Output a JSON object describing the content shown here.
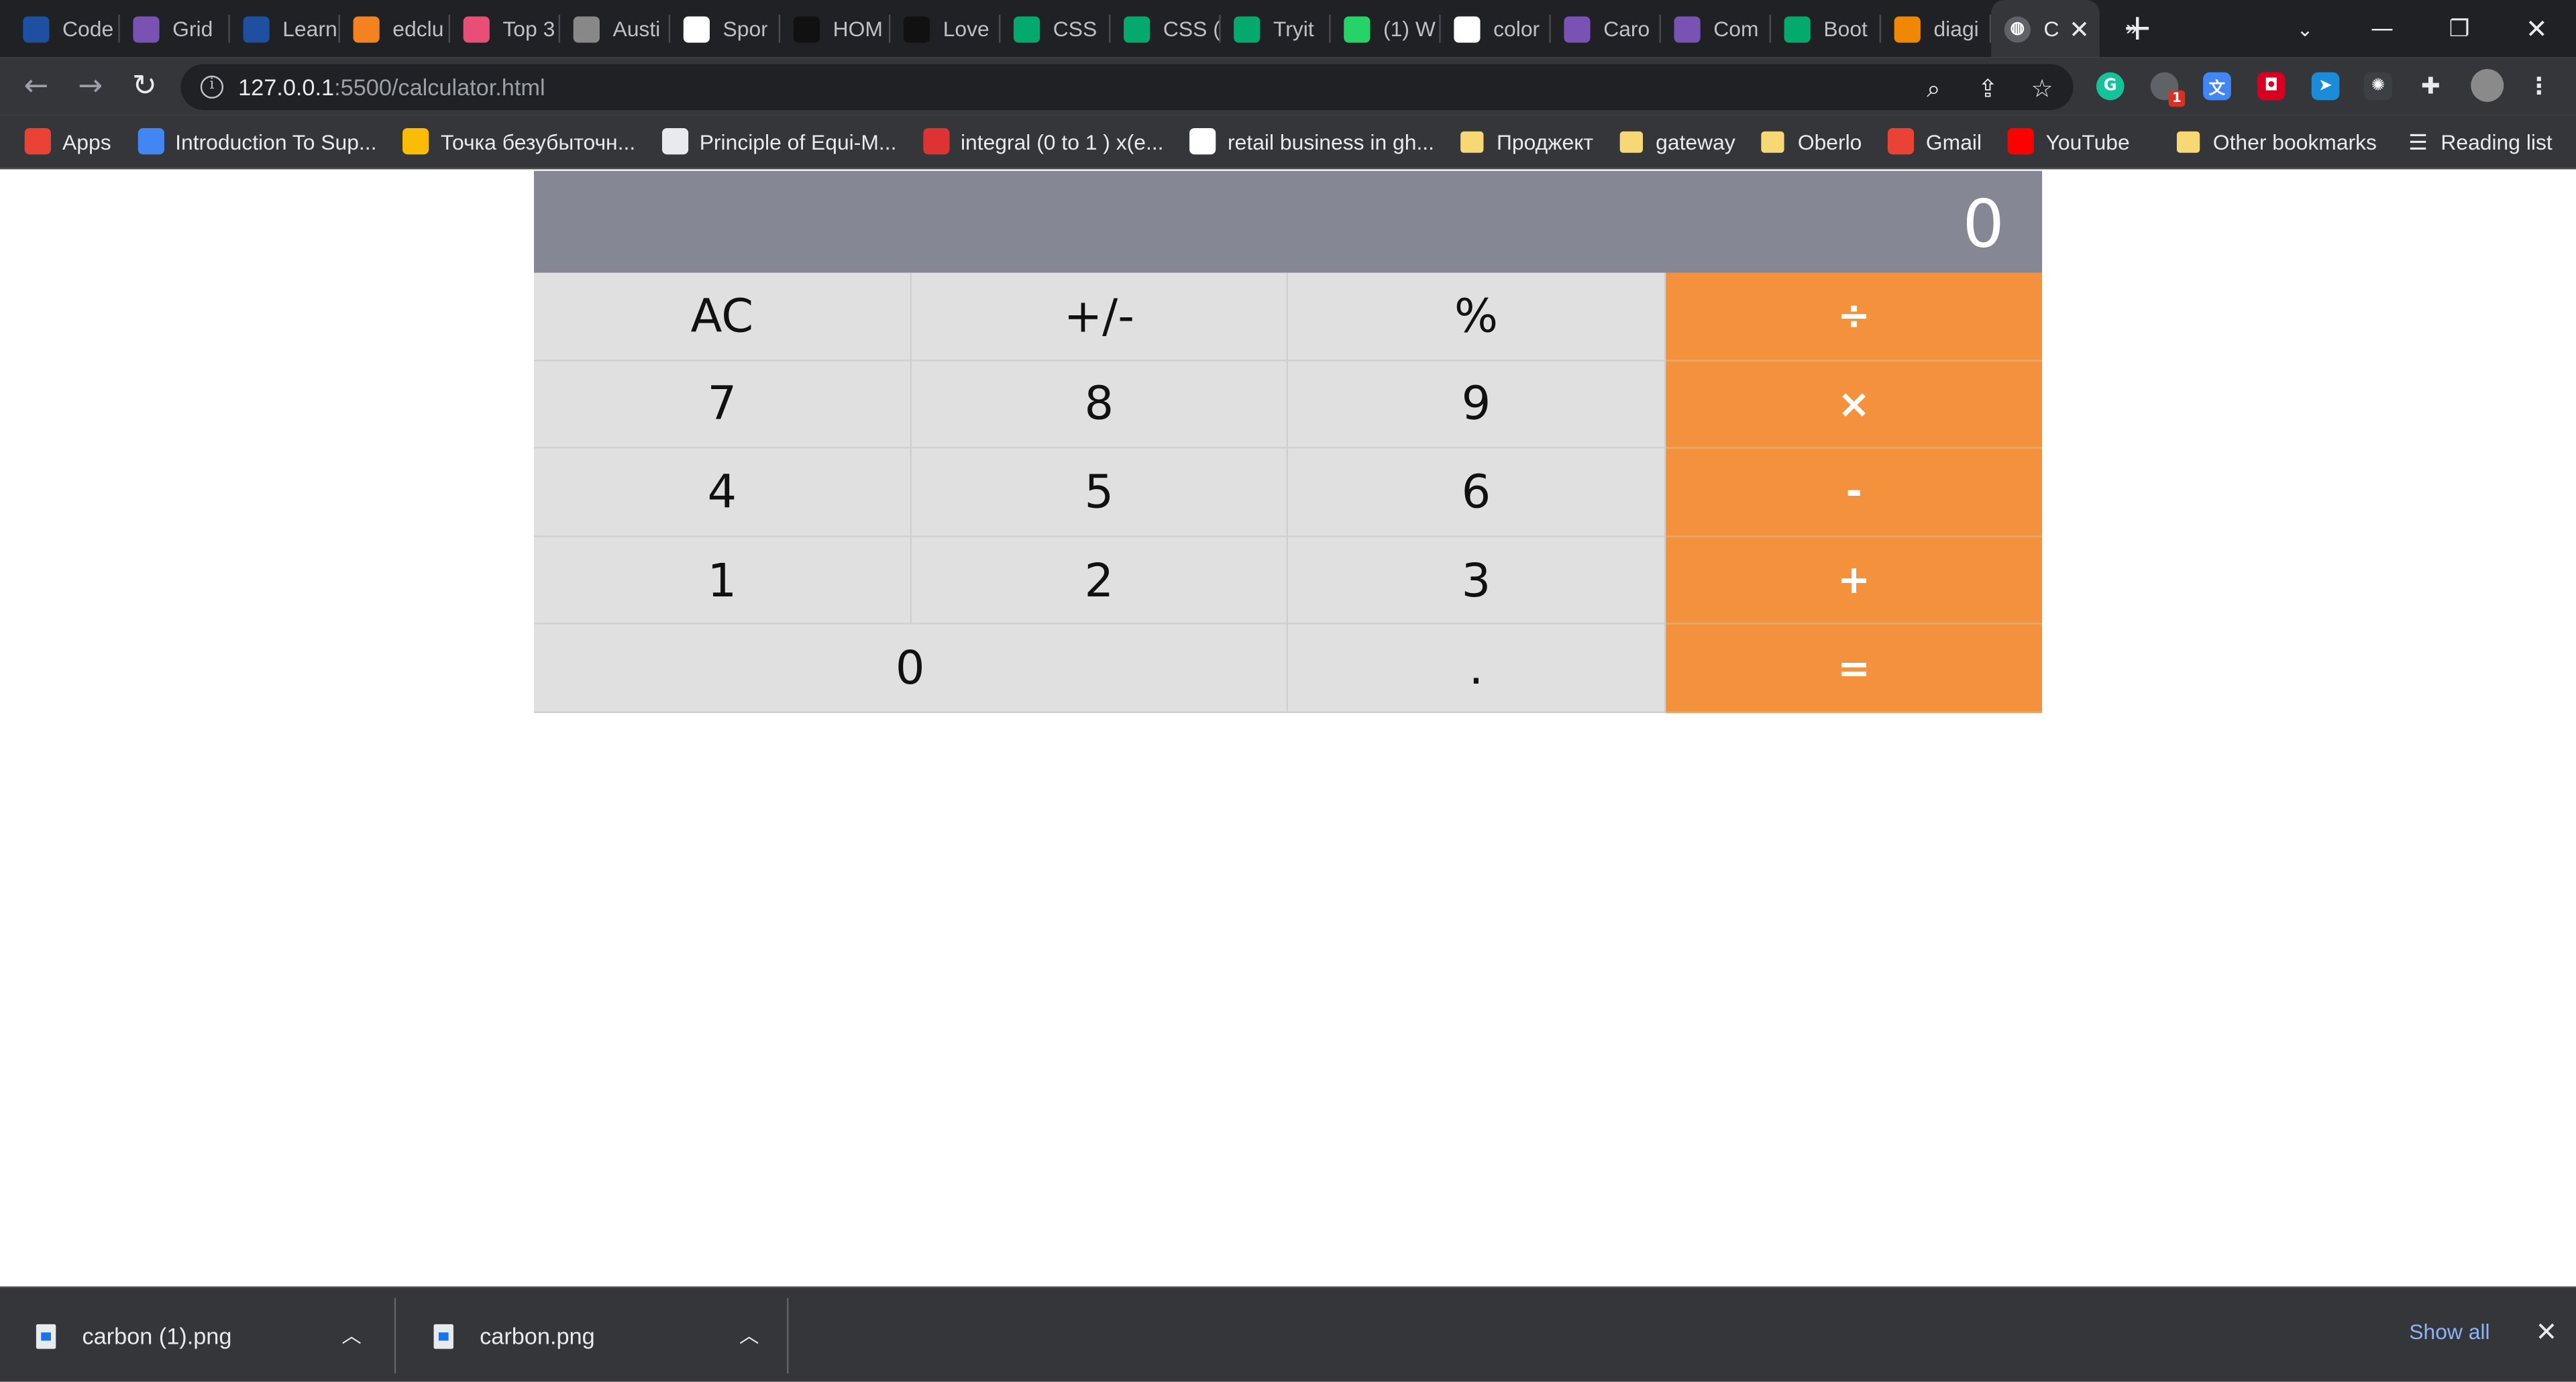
{
  "browser": {
    "tabs": [
      {
        "label": "Code",
        "icon": "codepen-icon",
        "color": "#1e4fa0"
      },
      {
        "label": "Grid",
        "icon": "bootstrap-icon",
        "color": "#7952b3"
      },
      {
        "label": "Learn",
        "icon": "codepen-icon",
        "color": "#1e4fa0"
      },
      {
        "label": "edclu",
        "icon": "flame-icon",
        "color": "#f58220"
      },
      {
        "label": "Top 3",
        "icon": "mail-icon",
        "color": "#e94e77"
      },
      {
        "label": "Austi",
        "icon": "portrait-icon",
        "color": "#888888"
      },
      {
        "label": "Spor",
        "icon": "ls-icon",
        "color": "#ffffff"
      },
      {
        "label": "HOM",
        "icon": "plus-minus-icon",
        "color": "#111111"
      },
      {
        "label": "Love",
        "icon": "to-icon",
        "color": "#111111"
      },
      {
        "label": "CSS",
        "icon": "w3schools-icon",
        "color": "#04aa6d"
      },
      {
        "label": "CSS (",
        "icon": "w3schools-icon",
        "color": "#04aa6d"
      },
      {
        "label": "Tryit",
        "icon": "w3schools-icon",
        "color": "#04aa6d"
      },
      {
        "label": "(1) W",
        "icon": "whatsapp-icon",
        "color": "#25d366"
      },
      {
        "label": "color",
        "icon": "google-icon",
        "color": "#ffffff"
      },
      {
        "label": "Caro",
        "icon": "bootstrap-icon",
        "color": "#7952b3"
      },
      {
        "label": "Com",
        "icon": "bootstrap-icon",
        "color": "#7952b3"
      },
      {
        "label": "Boot",
        "icon": "w3schools-icon",
        "color": "#04aa6d"
      },
      {
        "label": "diagi",
        "icon": "diagram-icon",
        "color": "#f08705"
      }
    ],
    "active_tab": {
      "label": "C",
      "icon": "globe-icon"
    },
    "url_host": "127.0.0.1",
    "url_path": ":5500/calculator.html",
    "bookmarks": [
      {
        "label": "Apps",
        "icon": "apps-grid-icon"
      },
      {
        "label": "Introduction To Sup...",
        "icon": "chart-line-icon"
      },
      {
        "label": "Точка безубыточн...",
        "icon": "bar-chart-icon"
      },
      {
        "label": "Principle of Equi-M...",
        "icon": "globe-icon"
      },
      {
        "label": "integral (0 to 1 ) x(e...",
        "icon": "symbolab-icon"
      },
      {
        "label": "retail business in gh...",
        "icon": "google-icon"
      },
      {
        "label": "Проджект",
        "icon": "folder-icon"
      },
      {
        "label": "gateway",
        "icon": "folder-icon"
      },
      {
        "label": "Oberlo",
        "icon": "folder-icon"
      },
      {
        "label": "Gmail",
        "icon": "gmail-icon"
      },
      {
        "label": "YouTube",
        "icon": "youtube-icon"
      }
    ],
    "more_bookmarks": "»",
    "other_bookmarks": "Other bookmarks",
    "reading_list": "Reading list"
  },
  "calculator": {
    "display": "0",
    "keys": [
      {
        "label": "AC",
        "type": "fn"
      },
      {
        "label": "+/-",
        "type": "fn"
      },
      {
        "label": "%",
        "type": "fn"
      },
      {
        "label": "÷",
        "type": "op"
      },
      {
        "label": "7",
        "type": "num"
      },
      {
        "label": "8",
        "type": "num"
      },
      {
        "label": "9",
        "type": "num"
      },
      {
        "label": "×",
        "type": "op"
      },
      {
        "label": "4",
        "type": "num"
      },
      {
        "label": "5",
        "type": "num"
      },
      {
        "label": "6",
        "type": "num"
      },
      {
        "label": "-",
        "type": "op"
      },
      {
        "label": "1",
        "type": "num"
      },
      {
        "label": "2",
        "type": "num"
      },
      {
        "label": "3",
        "type": "num"
      },
      {
        "label": "+",
        "type": "op"
      },
      {
        "label": "0",
        "type": "num"
      },
      {
        "label": ".",
        "type": "num"
      },
      {
        "label": "=",
        "type": "op"
      }
    ],
    "colors": {
      "display_bg": "#858794",
      "key_bg": "#e0e0e0",
      "operator_bg": "#f4913c"
    }
  },
  "downloads": {
    "items": [
      {
        "name": "carbon (1).png"
      },
      {
        "name": "carbon.png"
      }
    ],
    "show_all": "Show all"
  }
}
